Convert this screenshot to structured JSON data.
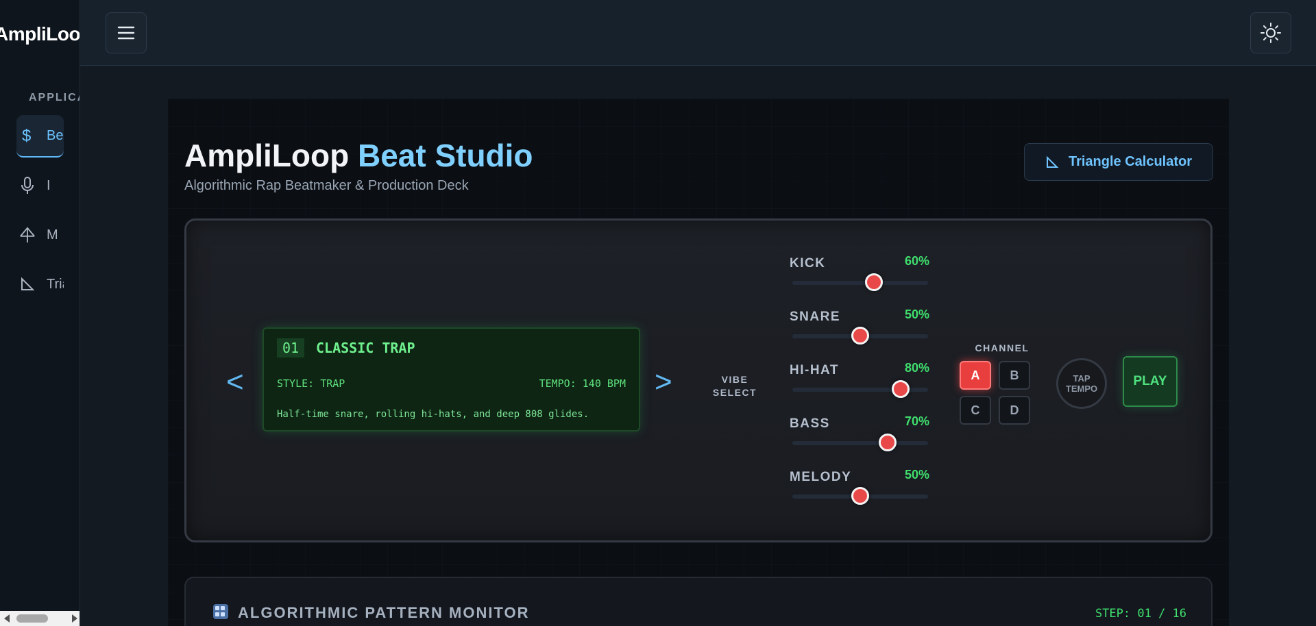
{
  "app": {
    "brand": "AmpliLoop"
  },
  "sidebar": {
    "section_label": "APPLICATIONS",
    "items": [
      {
        "icon": "dollar-icon",
        "label": "Beat Studio",
        "active": true
      },
      {
        "icon": "microphone-icon",
        "label": "I"
      },
      {
        "icon": "antenna-icon",
        "label": "M"
      },
      {
        "icon": "triangle-ruler-icon",
        "label": "Triangle Calculator"
      }
    ]
  },
  "topbar": {
    "menu_icon": "hamburger-menu-icon",
    "theme_icon": "sun-icon"
  },
  "header": {
    "title_part1": "AmpliLoop ",
    "title_part2": "Beat Studio",
    "subtitle": "Algorithmic Rap Beatmaker & Production Deck",
    "triangle_button": "Triangle Calculator"
  },
  "deck": {
    "prev_label": "<",
    "next_label": ">",
    "preset": {
      "number": "01",
      "name": "CLASSIC TRAP",
      "style": "STYLE: TRAP",
      "tempo": "TEMPO: 140 BPM",
      "description": "Half-time snare, rolling hi-hats, and deep 808 glides."
    },
    "vibe_select_line1": "VIBE",
    "vibe_select_line2": "SELECT",
    "mixer": [
      {
        "label": "KICK",
        "value": "60%",
        "level": 0.6
      },
      {
        "label": "SNARE",
        "value": "50%",
        "level": 0.5
      },
      {
        "label": "HI-HAT",
        "value": "80%",
        "level": 0.8
      },
      {
        "label": "BASS",
        "value": "70%",
        "level": 0.7
      },
      {
        "label": "MELODY",
        "value": "50%",
        "level": 0.5
      }
    ],
    "channel_label": "CHANNEL",
    "channels": [
      "A",
      "B",
      "C",
      "D"
    ],
    "active_channel": "A",
    "tap_line1": "TAP",
    "tap_line2": "TEMPO",
    "play_label": "PLAY"
  },
  "monitor": {
    "title": "ALGORITHMIC PATTERN MONITOR",
    "step": "STEP: 01 / 16"
  },
  "colors": {
    "accent_blue": "#6fc4ff",
    "lcd_green": "#5fe07e",
    "knob_red": "#e94848",
    "level_green": "#3fe06e"
  }
}
